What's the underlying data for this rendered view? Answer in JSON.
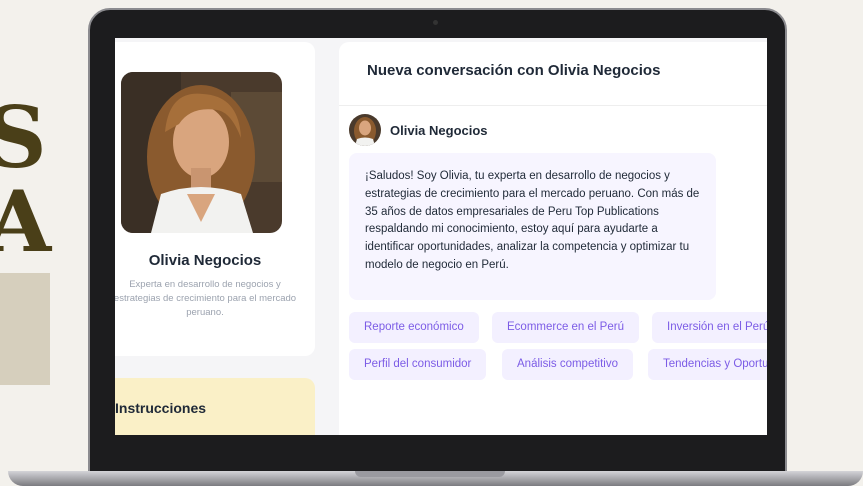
{
  "background": {
    "letter_1": "S",
    "letter_2": "A"
  },
  "profile": {
    "name": "Olivia Negocios",
    "description": "Experta en desarrollo de negocios y estrategias de crecimiento para el mercado peruano."
  },
  "instructions": {
    "title": "Instrucciones"
  },
  "chat": {
    "title": "Nueva conversación con Olivia Negocios",
    "sender": "Olivia Negocios",
    "message": "¡Saludos! Soy Olivia, tu experta en desarrollo de negocios y estrategias de crecimiento para el mercado peruano. Con más de 35 años de datos empresariales de Peru Top Publications respaldando mi conocimiento, estoy aquí para ayudarte a identificar oportunidades, analizar la competencia y optimizar tu modelo de negocio en Perú.",
    "suggestions": [
      "Reporte económico",
      "Ecommerce en el Perú",
      "Inversión en el Perú",
      "Perfil del consumidor",
      "Análisis competitivo",
      "Tendencias y Oportunidades"
    ]
  },
  "colors": {
    "accent": "#7c5ce6",
    "chip_bg": "#f3f0ff",
    "message_bg": "#f7f5ff",
    "instructions_bg": "#faf0c7"
  }
}
